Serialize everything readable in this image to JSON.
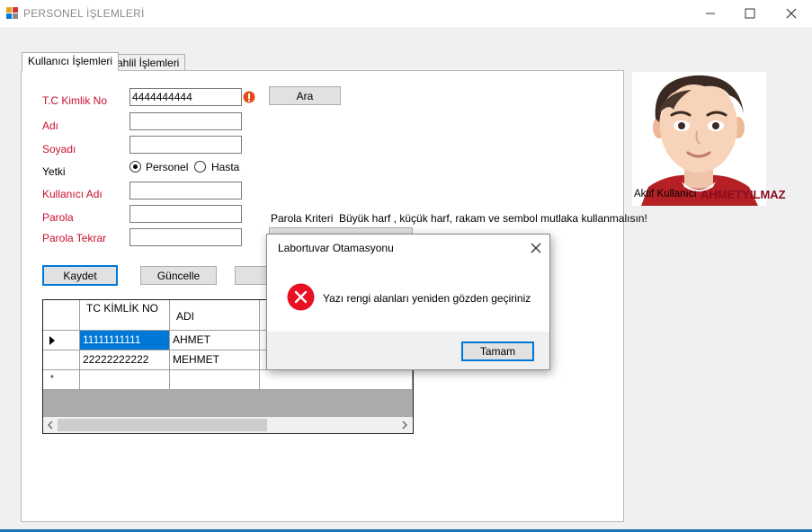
{
  "window": {
    "title": "PERSONEL İŞLEMLERİ",
    "controls": {
      "minimize": "—",
      "maximize": "☐",
      "close": "✕"
    }
  },
  "tabs": [
    {
      "label": "Kullanıcı İşlemleri",
      "active": true
    },
    {
      "label": "Tahlil İşlemleri",
      "active": false
    }
  ],
  "form": {
    "tc": {
      "label": "T.C Kimlik No",
      "value": "4444444444"
    },
    "name": {
      "label": "Adı",
      "value": ""
    },
    "surname": {
      "label": "Soyadı",
      "value": ""
    },
    "role": {
      "label": "Yetki",
      "options": [
        "Personel",
        "Hasta"
      ],
      "selected": "Personel"
    },
    "username": {
      "label": "Kullanıcı Adı",
      "value": ""
    },
    "password": {
      "label": "Parola",
      "value": ""
    },
    "password_repeat": {
      "label": "Parola Tekrar",
      "value": ""
    },
    "search_button": "Ara",
    "password_criteria_label": "Parola Kriteri",
    "password_criteria_text": "Büyük harf , küçük harf, rakam ve sembol mutlaka kullanmalısın!",
    "save_button": "Kaydet",
    "update_button": "Güncelle"
  },
  "table": {
    "headers": [
      "TC KİMLİK NO",
      "ADI"
    ],
    "rows": [
      {
        "tc": "11111111111",
        "name": "AHMET"
      },
      {
        "tc": "22222222222",
        "name": "MEHMET"
      }
    ],
    "new_row_marker": "*"
  },
  "profile": {
    "active_user_label": "Aktif Kullanıcı",
    "active_user_name": "AHMETYILMAZ"
  },
  "dialog": {
    "title": "Labortuvar Otamasyonu",
    "message": "Yazı rengi alanları yeniden gözden geçiriniz",
    "ok_button": "Tamam",
    "icon": "error-icon"
  },
  "colors": {
    "label_red": "#c8102e",
    "selection_blue": "#0078d7",
    "error_red": "#e81123",
    "accent_line": "#1a76b9"
  }
}
